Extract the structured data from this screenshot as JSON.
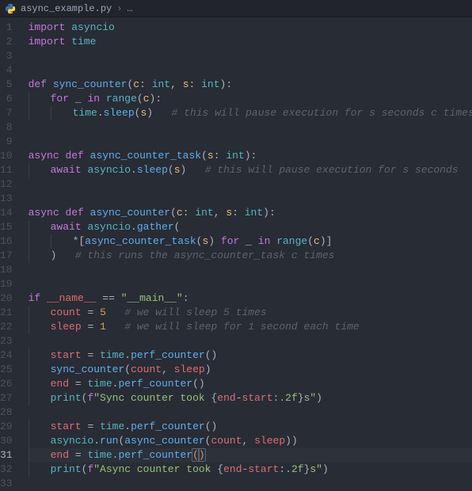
{
  "breadcrumb": {
    "file_icon": "python-file-icon",
    "filename": "async_example.py",
    "trail": "…"
  },
  "active_line": 31,
  "lines": [
    {
      "n": 1,
      "tokens": [
        [
          "kw",
          "import"
        ],
        [
          "wt",
          " "
        ],
        [
          "bt",
          "asyncio"
        ]
      ]
    },
    {
      "n": 2,
      "tokens": [
        [
          "kw",
          "import"
        ],
        [
          "wt",
          " "
        ],
        [
          "bt",
          "time"
        ]
      ]
    },
    {
      "n": 3,
      "tokens": []
    },
    {
      "n": 4,
      "tokens": []
    },
    {
      "n": 5,
      "tokens": [
        [
          "kw",
          "def"
        ],
        [
          "wt",
          " "
        ],
        [
          "fn",
          "sync_counter"
        ],
        [
          "op",
          "("
        ],
        [
          "pr",
          "c"
        ],
        [
          "op",
          ": "
        ],
        [
          "bt",
          "int"
        ],
        [
          "op",
          ", "
        ],
        [
          "pr",
          "s"
        ],
        [
          "op",
          ": "
        ],
        [
          "bt",
          "int"
        ],
        [
          "op",
          ")"
        ],
        [
          "op",
          ":"
        ]
      ]
    },
    {
      "n": 6,
      "indent": 1,
      "tokens": [
        [
          "kw",
          "for"
        ],
        [
          "wt",
          " "
        ],
        [
          "wt",
          "_"
        ],
        [
          "wt",
          " "
        ],
        [
          "kw",
          "in"
        ],
        [
          "wt",
          " "
        ],
        [
          "bt",
          "range"
        ],
        [
          "op",
          "("
        ],
        [
          "pr",
          "c"
        ],
        [
          "op",
          ")"
        ],
        [
          "op",
          ":"
        ]
      ]
    },
    {
      "n": 7,
      "indent": 2,
      "tokens": [
        [
          "bt",
          "time"
        ],
        [
          "op",
          "."
        ],
        [
          "fn",
          "sleep"
        ],
        [
          "op",
          "("
        ],
        [
          "pr",
          "s"
        ],
        [
          "op",
          ")"
        ],
        [
          "wt",
          "   "
        ],
        [
          "cm",
          "# this will pause execution for s seconds c times"
        ]
      ]
    },
    {
      "n": 8,
      "tokens": []
    },
    {
      "n": 9,
      "tokens": []
    },
    {
      "n": 10,
      "tokens": [
        [
          "kw",
          "async"
        ],
        [
          "wt",
          " "
        ],
        [
          "kw",
          "def"
        ],
        [
          "wt",
          " "
        ],
        [
          "fn",
          "async_counter_task"
        ],
        [
          "op",
          "("
        ],
        [
          "pr",
          "s"
        ],
        [
          "op",
          ": "
        ],
        [
          "bt",
          "int"
        ],
        [
          "op",
          ")"
        ],
        [
          "op",
          ":"
        ]
      ]
    },
    {
      "n": 11,
      "indent": 1,
      "tokens": [
        [
          "kw",
          "await"
        ],
        [
          "wt",
          " "
        ],
        [
          "bt",
          "asyncio"
        ],
        [
          "op",
          "."
        ],
        [
          "fn",
          "sleep"
        ],
        [
          "op",
          "("
        ],
        [
          "pr",
          "s"
        ],
        [
          "op",
          ")"
        ],
        [
          "wt",
          "   "
        ],
        [
          "cm",
          "# this will pause execution for s seconds"
        ]
      ]
    },
    {
      "n": 12,
      "tokens": []
    },
    {
      "n": 13,
      "tokens": []
    },
    {
      "n": 14,
      "tokens": [
        [
          "kw",
          "async"
        ],
        [
          "wt",
          " "
        ],
        [
          "kw",
          "def"
        ],
        [
          "wt",
          " "
        ],
        [
          "fn",
          "async_counter"
        ],
        [
          "op",
          "("
        ],
        [
          "pr",
          "c"
        ],
        [
          "op",
          ": "
        ],
        [
          "bt",
          "int"
        ],
        [
          "op",
          ", "
        ],
        [
          "pr",
          "s"
        ],
        [
          "op",
          ": "
        ],
        [
          "bt",
          "int"
        ],
        [
          "op",
          ")"
        ],
        [
          "op",
          ":"
        ]
      ]
    },
    {
      "n": 15,
      "indent": 1,
      "tokens": [
        [
          "kw",
          "await"
        ],
        [
          "wt",
          " "
        ],
        [
          "bt",
          "asyncio"
        ],
        [
          "op",
          "."
        ],
        [
          "fn",
          "gather"
        ],
        [
          "op",
          "("
        ]
      ]
    },
    {
      "n": 16,
      "indent": 2,
      "tokens": [
        [
          "op",
          "*"
        ],
        [
          "op",
          "["
        ],
        [
          "fn",
          "async_counter_task"
        ],
        [
          "op",
          "("
        ],
        [
          "pr",
          "s"
        ],
        [
          "op",
          ")"
        ],
        [
          "wt",
          " "
        ],
        [
          "kw",
          "for"
        ],
        [
          "wt",
          " "
        ],
        [
          "wt",
          "_"
        ],
        [
          "wt",
          " "
        ],
        [
          "kw",
          "in"
        ],
        [
          "wt",
          " "
        ],
        [
          "bt",
          "range"
        ],
        [
          "op",
          "("
        ],
        [
          "pr",
          "c"
        ],
        [
          "op",
          ")"
        ],
        [
          "op",
          "]"
        ]
      ]
    },
    {
      "n": 17,
      "indent": 1,
      "tokens": [
        [
          "op",
          ")"
        ],
        [
          "wt",
          "   "
        ],
        [
          "cm",
          "# this runs the async_counter_task c times"
        ]
      ]
    },
    {
      "n": 18,
      "tokens": []
    },
    {
      "n": 19,
      "tokens": []
    },
    {
      "n": 20,
      "tokens": [
        [
          "kw",
          "if"
        ],
        [
          "wt",
          " "
        ],
        [
          "re",
          "__name__"
        ],
        [
          "wt",
          " "
        ],
        [
          "op",
          "=="
        ],
        [
          "wt",
          " "
        ],
        [
          "st",
          "\"__main__\""
        ],
        [
          "op",
          ":"
        ]
      ]
    },
    {
      "n": 21,
      "indent": 1,
      "tokens": [
        [
          "re",
          "count"
        ],
        [
          "wt",
          " "
        ],
        [
          "op",
          "="
        ],
        [
          "wt",
          " "
        ],
        [
          "py",
          "5"
        ],
        [
          "wt",
          "   "
        ],
        [
          "cm",
          "# we will sleep 5 times"
        ]
      ]
    },
    {
      "n": 22,
      "indent": 1,
      "tokens": [
        [
          "re",
          "sleep"
        ],
        [
          "wt",
          " "
        ],
        [
          "op",
          "="
        ],
        [
          "wt",
          " "
        ],
        [
          "py",
          "1"
        ],
        [
          "wt",
          "   "
        ],
        [
          "cm",
          "# we will sleep for 1 second each time"
        ]
      ]
    },
    {
      "n": 23,
      "tokens": []
    },
    {
      "n": 24,
      "indent": 1,
      "tokens": [
        [
          "re",
          "start"
        ],
        [
          "wt",
          " "
        ],
        [
          "op",
          "="
        ],
        [
          "wt",
          " "
        ],
        [
          "bt",
          "time"
        ],
        [
          "op",
          "."
        ],
        [
          "fn",
          "perf_counter"
        ],
        [
          "op",
          "("
        ],
        [
          "op",
          ")"
        ]
      ]
    },
    {
      "n": 25,
      "indent": 1,
      "tokens": [
        [
          "fn",
          "sync_counter"
        ],
        [
          "op",
          "("
        ],
        [
          "re",
          "count"
        ],
        [
          "op",
          ", "
        ],
        [
          "re",
          "sleep"
        ],
        [
          "op",
          ")"
        ]
      ]
    },
    {
      "n": 26,
      "indent": 1,
      "tokens": [
        [
          "re",
          "end"
        ],
        [
          "wt",
          " "
        ],
        [
          "op",
          "="
        ],
        [
          "wt",
          " "
        ],
        [
          "bt",
          "time"
        ],
        [
          "op",
          "."
        ],
        [
          "fn",
          "perf_counter"
        ],
        [
          "op",
          "("
        ],
        [
          "op",
          ")"
        ]
      ]
    },
    {
      "n": 27,
      "indent": 1,
      "tokens": [
        [
          "bt",
          "print"
        ],
        [
          "op",
          "("
        ],
        [
          "kw",
          "f"
        ],
        [
          "st",
          "\"Sync counter took "
        ],
        [
          "op",
          "{"
        ],
        [
          "re",
          "end"
        ],
        [
          "op",
          "-"
        ],
        [
          "re",
          "start"
        ],
        [
          "op",
          ":"
        ],
        [
          "st",
          ".2f"
        ],
        [
          "op",
          "}"
        ],
        [
          "st",
          "s\""
        ],
        [
          "op",
          ")"
        ]
      ]
    },
    {
      "n": 28,
      "tokens": []
    },
    {
      "n": 29,
      "indent": 1,
      "tokens": [
        [
          "re",
          "start"
        ],
        [
          "wt",
          " "
        ],
        [
          "op",
          "="
        ],
        [
          "wt",
          " "
        ],
        [
          "bt",
          "time"
        ],
        [
          "op",
          "."
        ],
        [
          "fn",
          "perf_counter"
        ],
        [
          "op",
          "("
        ],
        [
          "op",
          ")"
        ]
      ]
    },
    {
      "n": 30,
      "indent": 1,
      "tokens": [
        [
          "bt",
          "asyncio"
        ],
        [
          "op",
          "."
        ],
        [
          "fn",
          "run"
        ],
        [
          "op",
          "("
        ],
        [
          "fn",
          "async_counter"
        ],
        [
          "op",
          "("
        ],
        [
          "re",
          "count"
        ],
        [
          "op",
          ", "
        ],
        [
          "re",
          "sleep"
        ],
        [
          "op",
          ")"
        ],
        [
          "op",
          ")"
        ]
      ]
    },
    {
      "n": 31,
      "indent": 1,
      "tokens": [
        [
          "re",
          "end"
        ],
        [
          "wt",
          " "
        ],
        [
          "op",
          "="
        ],
        [
          "wt",
          " "
        ],
        [
          "bt",
          "time"
        ],
        [
          "op",
          "."
        ],
        [
          "fn",
          "perf_counter"
        ],
        [
          "brace",
          "("
        ],
        [
          "brace",
          ")"
        ]
      ]
    },
    {
      "n": 32,
      "indent": 1,
      "tokens": [
        [
          "bt",
          "print"
        ],
        [
          "op",
          "("
        ],
        [
          "kw",
          "f"
        ],
        [
          "st",
          "\"Async counter took "
        ],
        [
          "op",
          "{"
        ],
        [
          "re",
          "end"
        ],
        [
          "op",
          "-"
        ],
        [
          "re",
          "start"
        ],
        [
          "op",
          ":"
        ],
        [
          "st",
          ".2f"
        ],
        [
          "op",
          "}"
        ],
        [
          "st",
          "s\""
        ],
        [
          "op",
          ")"
        ]
      ]
    },
    {
      "n": 33,
      "tokens": []
    }
  ]
}
